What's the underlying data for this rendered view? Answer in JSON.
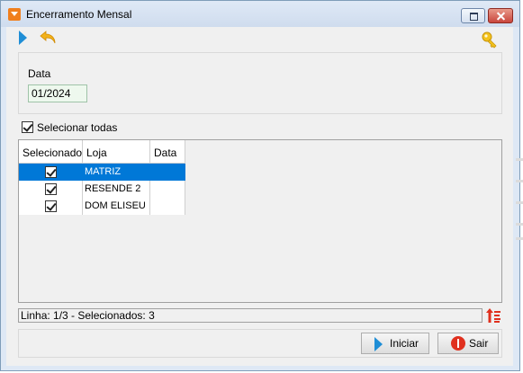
{
  "window": {
    "title": "Encerramento Mensal"
  },
  "toolbar": {
    "play_icon": "play-icon",
    "undo_icon": "undo-icon",
    "key_icon": "key-icon"
  },
  "filter": {
    "date_label": "Data",
    "date_value": "01/2024"
  },
  "select_all": {
    "label": "Selecionar todas",
    "checked": true
  },
  "grid": {
    "columns": [
      "Selecionado",
      "Loja",
      "Data"
    ],
    "rows": [
      {
        "selected": true,
        "loja": "MATRIZ",
        "data": "",
        "highlighted": true
      },
      {
        "selected": true,
        "loja": "RESENDE 2",
        "data": "",
        "highlighted": false
      },
      {
        "selected": true,
        "loja": "DOM ELISEU",
        "data": "",
        "highlighted": false
      }
    ]
  },
  "status": {
    "text": "Linha: 1/3 - Selecionados: 3"
  },
  "buttons": {
    "start_label": "Iniciar",
    "exit_label": "Sair"
  },
  "colors": {
    "selection": "#0078d7",
    "accent_play": "#1f8ed6",
    "stop": "#e0301e"
  }
}
